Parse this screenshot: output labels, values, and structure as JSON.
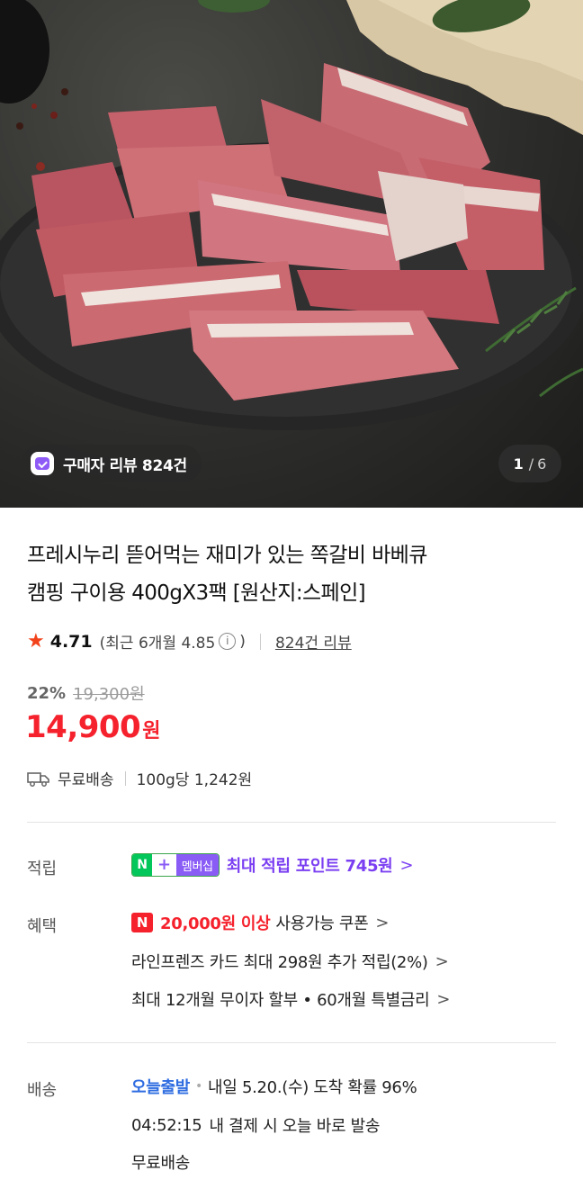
{
  "hero": {
    "review_pill": "구매자 리뷰 824건",
    "pager_current": "1",
    "pager_total": "6"
  },
  "product": {
    "title_line1": "프레시누리 뜯어먹는 재미가 있는 쪽갈비 바베큐",
    "title_line2": "캠핑 구이용 400gX3팩 [원산지:스페인]",
    "rating": "4.71",
    "recent_rating_prefix": "(최근 6개월 4.85",
    "recent_rating_suffix": ")",
    "review_count_link": "824건 리뷰",
    "discount_rate": "22%",
    "original_price": "19,300원",
    "price": "14,900",
    "price_unit": "원",
    "shipping": "무료배송",
    "unit_price": "100g당 1,242원"
  },
  "benefits": {
    "points_label": "적립",
    "np_n": "N",
    "np_plus": "+",
    "np_member": "멤버십",
    "points_text": "최대 적립 포인트 745원",
    "benefit_label": "혜택",
    "coupon_badge": "N",
    "coupon_amount": "20,000원 이상",
    "coupon_text": "사용가능 쿠폰",
    "card_text": "라인프렌즈 카드 최대 298원 추가 적립(2%)",
    "installment_text": "최대 12개월 무이자 할부 • 60개월 특별금리"
  },
  "delivery": {
    "label": "배송",
    "today_badge": "오늘출발",
    "arrival_text": "내일 5.20.(수) 도착 확률 96%",
    "countdown": "04:52:15",
    "countdown_text": "내 결제 시 오늘 바로 발송",
    "free_shipping": "무료배송"
  },
  "icons": {
    "review": "review-check-icon",
    "star": "star-icon",
    "info": "info-icon",
    "truck": "truck-icon",
    "chevron": "chevron-right-icon"
  },
  "colors": {
    "price_red": "#f5222d",
    "purple": "#7b3ff2",
    "naver_green": "#03c75a",
    "today_blue": "#2f6de1"
  }
}
